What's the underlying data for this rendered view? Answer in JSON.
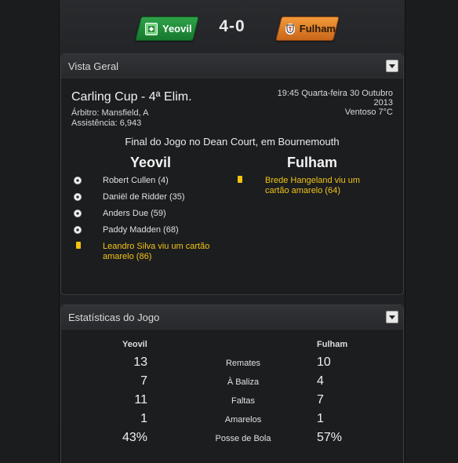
{
  "match": {
    "home_team": "Yeovil",
    "away_team": "Fulham",
    "score": "4-0"
  },
  "overview": {
    "title": "Vista Geral",
    "competition": "Carling Cup - 4ª Elim.",
    "referee": "Árbitro: Mansfield, A",
    "attendance": "Assistência: 6,943",
    "datetime_line1": "19:45 Quarta-feira 30 Outubro",
    "datetime_line2": "2013",
    "weather": "Ventoso 7°C",
    "final_text": "Final do Jogo no Dean Court, em Bournemouth",
    "home_header": "Yeovil",
    "away_header": "Fulham",
    "home_events": [
      {
        "type": "goal-icon",
        "text": "Robert Cullen (4)"
      },
      {
        "type": "goal-icon",
        "text": "Daniël de Ridder (35)"
      },
      {
        "type": "goal-icon",
        "text": "Anders Due (59)"
      },
      {
        "type": "goal-icon",
        "text": "Paddy Madden (68)"
      },
      {
        "type": "yellow-card-icon",
        "line1": "Leandro Silva viu um cartão",
        "line2": "amarelo (86)"
      }
    ],
    "away_events": [
      {
        "type": "yellow-card-icon",
        "line1": "Brede Hangeland viu um",
        "line2": "cartão amarelo (64)"
      }
    ]
  },
  "stats": {
    "title": "Estatísticas do Jogo",
    "home_header": "Yeovil",
    "away_header": "Fulham",
    "rows": [
      {
        "label": "Remates",
        "home": "13",
        "away": "10"
      },
      {
        "label": "À Baliza",
        "home": "7",
        "away": "4"
      },
      {
        "label": "Faltas",
        "home": "11",
        "away": "7"
      },
      {
        "label": "Amarelos",
        "home": "1",
        "away": "1"
      },
      {
        "label": "Posse de Bola",
        "home": "43%",
        "away": "57%"
      }
    ]
  },
  "colors": {
    "home_accent": "#1f8f3c",
    "away_accent": "#e07d27",
    "card_text": "#f0c419"
  }
}
